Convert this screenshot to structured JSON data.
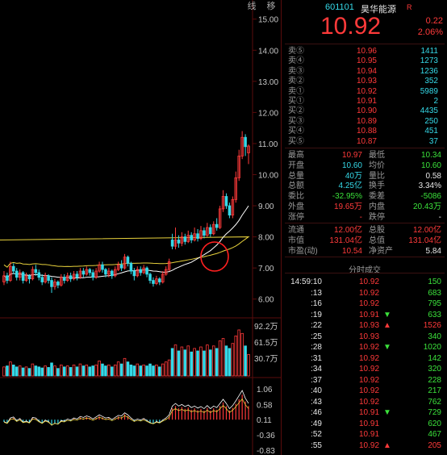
{
  "chart_tabs": [
    "线",
    "移"
  ],
  "price_axis": [
    "15.00",
    "14.00",
    "13.00",
    "12.00",
    "11.00",
    "10.00",
    "9.00",
    "8.00",
    "7.00",
    "6.00"
  ],
  "volume_axis": [
    "92.2万",
    "61.5万",
    "30.7万"
  ],
  "macd_axis": [
    "1.06",
    "0.58",
    "0.11",
    "-0.36",
    "-0.83"
  ],
  "colors": {
    "up": "#ff3a3a",
    "down": "#35d9e8",
    "flat": "#3be23b",
    "ma_white": "#ffffff",
    "ma_yellow": "#e8d23c",
    "grid": "#5a0c0c"
  },
  "stock": {
    "code": "601101",
    "name": "昊华能源",
    "flag": "R",
    "price": "10.92",
    "change": "0.22",
    "change_pct": "2.06%"
  },
  "order_book": [
    {
      "label": "卖⑤",
      "price": "10.96",
      "volume": "1411"
    },
    {
      "label": "卖④",
      "price": "10.95",
      "volume": "1273"
    },
    {
      "label": "卖③",
      "price": "10.94",
      "volume": "1236"
    },
    {
      "label": "卖②",
      "price": "10.93",
      "volume": "352"
    },
    {
      "label": "卖①",
      "price": "10.92",
      "volume": "5989"
    },
    {
      "label": "买①",
      "price": "10.91",
      "volume": "2"
    },
    {
      "label": "买②",
      "price": "10.90",
      "volume": "4435"
    },
    {
      "label": "买③",
      "price": "10.89",
      "volume": "250"
    },
    {
      "label": "买④",
      "price": "10.88",
      "volume": "451"
    },
    {
      "label": "买⑤",
      "price": "10.87",
      "volume": "37"
    }
  ],
  "stats": [
    {
      "l1": "最高",
      "v1": "10.97",
      "l2": "最低",
      "v2": "10.34"
    },
    {
      "l1": "开盘",
      "v1": "10.60",
      "l2": "均价",
      "v2": "10.60"
    },
    {
      "l1": "总量",
      "v1": "40万",
      "l2": "量比",
      "v2": "0.58"
    },
    {
      "l1": "总额",
      "v1": "4.25亿",
      "l2": "换手",
      "v2": "3.34%"
    },
    {
      "l1": "委比",
      "v1": "-32.95%",
      "l2": "委差",
      "v2": "-5086"
    },
    {
      "l1": "外盘",
      "v1": "19.65万",
      "l2": "内盘",
      "v2": "20.43万"
    },
    {
      "l1": "涨停",
      "v1": "-",
      "l2": "跌停",
      "v2": "-"
    }
  ],
  "stats2": [
    {
      "l1": "流通",
      "v1": "12.00亿",
      "l2": "总股",
      "v2": "12.00亿"
    },
    {
      "l1": "市值",
      "v1": "131.04亿",
      "l2": "总值",
      "v2": "131.04亿"
    },
    {
      "l1": "市盈(动)",
      "v1": "10.54",
      "l2": "净资产",
      "v2": "5.84"
    }
  ],
  "ticks_title": "分时成交",
  "ticks": [
    {
      "time": "14:59:10",
      "price": "10.92",
      "vol": "150",
      "arrow": ""
    },
    {
      "time": ":13",
      "price": "10.92",
      "vol": "683",
      "arrow": ""
    },
    {
      "time": ":16",
      "price": "10.92",
      "vol": "795",
      "arrow": ""
    },
    {
      "time": ":19",
      "price": "10.91",
      "vol": "633",
      "arrow": "▼"
    },
    {
      "time": ":22",
      "price": "10.93",
      "vol": "1526",
      "arrow": "▲"
    },
    {
      "time": ":25",
      "price": "10.93",
      "vol": "340",
      "arrow": ""
    },
    {
      "time": ":28",
      "price": "10.92",
      "vol": "1020",
      "arrow": "▼"
    },
    {
      "time": ":31",
      "price": "10.92",
      "vol": "142",
      "arrow": ""
    },
    {
      "time": ":34",
      "price": "10.92",
      "vol": "320",
      "arrow": ""
    },
    {
      "time": ":37",
      "price": "10.92",
      "vol": "228",
      "arrow": ""
    },
    {
      "time": ":40",
      "price": "10.92",
      "vol": "217",
      "arrow": ""
    },
    {
      "time": ":43",
      "price": "10.92",
      "vol": "762",
      "arrow": ""
    },
    {
      "time": ":46",
      "price": "10.91",
      "vol": "729",
      "arrow": "▼"
    },
    {
      "time": ":49",
      "price": "10.91",
      "vol": "620",
      "arrow": ""
    },
    {
      "time": ":52",
      "price": "10.91",
      "vol": "467",
      "arrow": ""
    },
    {
      "time": ":55",
      "price": "10.92",
      "vol": "205",
      "arrow": "▲"
    }
  ],
  "chart_data": {
    "type": "candlestick",
    "ylim": [
      5.5,
      15.2
    ],
    "candles": [
      [
        6.55,
        6.75,
        6.45,
        6.9
      ],
      [
        6.75,
        6.6,
        6.5,
        6.85
      ],
      [
        6.6,
        7.05,
        6.55,
        7.2
      ],
      [
        7.05,
        6.9,
        6.8,
        7.15
      ],
      [
        6.9,
        6.7,
        6.6,
        7.0
      ],
      [
        6.7,
        6.85,
        6.6,
        6.95
      ],
      [
        6.85,
        6.6,
        6.5,
        6.9
      ],
      [
        6.6,
        6.75,
        6.55,
        6.85
      ],
      [
        6.75,
        6.65,
        6.5,
        6.8
      ],
      [
        6.65,
        6.95,
        6.6,
        7.05
      ],
      [
        6.95,
        6.85,
        6.75,
        7.1
      ],
      [
        6.85,
        6.7,
        6.6,
        6.95
      ],
      [
        6.7,
        6.55,
        6.45,
        6.8
      ],
      [
        6.55,
        6.75,
        6.5,
        6.85
      ],
      [
        6.75,
        6.6,
        6.5,
        6.8
      ],
      [
        6.6,
        6.4,
        6.2,
        6.7
      ],
      [
        6.4,
        6.55,
        6.3,
        6.65
      ],
      [
        6.55,
        6.45,
        6.35,
        6.6
      ],
      [
        6.45,
        6.7,
        6.4,
        6.8
      ],
      [
        6.7,
        6.6,
        6.5,
        6.8
      ],
      [
        6.6,
        6.75,
        6.55,
        6.85
      ],
      [
        6.75,
        6.65,
        6.55,
        6.85
      ],
      [
        6.65,
        6.8,
        6.6,
        6.9
      ],
      [
        6.8,
        6.7,
        6.6,
        6.9
      ],
      [
        6.7,
        6.9,
        6.65,
        7.0
      ],
      [
        6.9,
        6.8,
        6.7,
        7.0
      ],
      [
        6.8,
        6.95,
        6.75,
        7.05
      ],
      [
        6.95,
        6.85,
        6.75,
        7.0
      ],
      [
        6.85,
        6.7,
        6.6,
        6.95
      ],
      [
        6.7,
        6.9,
        6.65,
        7.0
      ],
      [
        6.9,
        7.1,
        6.85,
        7.2
      ],
      [
        7.1,
        6.95,
        6.85,
        7.2
      ],
      [
        6.95,
        6.8,
        6.7,
        7.0
      ],
      [
        6.8,
        6.9,
        6.7,
        7.0
      ],
      [
        6.9,
        6.75,
        6.65,
        6.95
      ],
      [
        6.75,
        6.95,
        6.7,
        7.05
      ],
      [
        6.95,
        7.1,
        6.9,
        7.2
      ],
      [
        7.1,
        7.0,
        6.9,
        7.25
      ],
      [
        7.0,
        7.35,
        6.95,
        7.45
      ],
      [
        7.35,
        7.15,
        7.05,
        7.4
      ],
      [
        7.15,
        6.9,
        6.8,
        7.2
      ],
      [
        6.9,
        6.75,
        6.6,
        7.0
      ],
      [
        6.75,
        6.95,
        6.7,
        7.05
      ],
      [
        6.95,
        6.85,
        6.75,
        7.05
      ],
      [
        6.85,
        7.0,
        6.8,
        7.1
      ],
      [
        7.0,
        6.8,
        6.7,
        7.05
      ],
      [
        6.8,
        6.6,
        6.5,
        6.85
      ],
      [
        6.6,
        6.5,
        6.4,
        6.7
      ],
      [
        6.5,
        6.65,
        6.45,
        6.75
      ],
      [
        6.65,
        6.55,
        6.45,
        6.7
      ],
      [
        6.55,
        6.8,
        6.5,
        6.9
      ],
      [
        6.8,
        6.95,
        6.75,
        7.05
      ],
      [
        6.95,
        7.2,
        6.9,
        7.3
      ],
      [
        7.9,
        7.7,
        7.6,
        8.1
      ],
      [
        7.7,
        7.9,
        7.6,
        8.3
      ],
      [
        7.9,
        7.8,
        7.65,
        8.05
      ],
      [
        7.8,
        8.0,
        7.7,
        8.15
      ],
      [
        8.0,
        7.85,
        7.75,
        8.1
      ],
      [
        7.85,
        8.05,
        7.8,
        8.2
      ],
      [
        8.05,
        7.9,
        7.8,
        8.15
      ],
      [
        7.9,
        8.1,
        7.85,
        8.3
      ],
      [
        8.1,
        7.95,
        7.85,
        8.25
      ],
      [
        7.95,
        8.2,
        7.9,
        8.35
      ],
      [
        8.2,
        8.05,
        7.95,
        8.3
      ],
      [
        8.05,
        8.3,
        8.0,
        8.45
      ],
      [
        8.3,
        8.1,
        8.0,
        8.4
      ],
      [
        8.1,
        8.4,
        8.05,
        8.5
      ],
      [
        8.4,
        8.3,
        8.2,
        8.6
      ],
      [
        8.3,
        8.9,
        8.25,
        9.0
      ],
      [
        8.9,
        9.3,
        8.8,
        9.5
      ],
      [
        9.3,
        9.0,
        8.9,
        9.4
      ],
      [
        9.0,
        8.7,
        8.6,
        9.1
      ],
      [
        8.7,
        9.2,
        8.6,
        9.3
      ],
      [
        9.2,
        9.9,
        9.1,
        10.1
      ],
      [
        9.9,
        10.6,
        9.8,
        10.8
      ],
      [
        10.6,
        11.2,
        10.5,
        11.4
      ],
      [
        11.2,
        10.9,
        10.6,
        11.3
      ],
      [
        10.7,
        10.92,
        10.34,
        10.97
      ]
    ],
    "volumes": [
      0.18,
      0.2,
      0.28,
      0.22,
      0.18,
      0.2,
      0.16,
      0.18,
      0.15,
      0.24,
      0.2,
      0.18,
      0.16,
      0.2,
      0.17,
      0.26,
      0.2,
      0.15,
      0.22,
      0.18,
      0.2,
      0.17,
      0.22,
      0.18,
      0.24,
      0.2,
      0.22,
      0.18,
      0.2,
      0.22,
      0.3,
      0.24,
      0.2,
      0.22,
      0.18,
      0.22,
      0.28,
      0.24,
      0.35,
      0.28,
      0.22,
      0.2,
      0.24,
      0.2,
      0.22,
      0.2,
      0.24,
      0.2,
      0.22,
      0.18,
      0.24,
      0.28,
      0.32,
      0.55,
      0.62,
      0.5,
      0.58,
      0.52,
      0.6,
      0.48,
      0.55,
      0.5,
      0.58,
      0.5,
      0.62,
      0.52,
      0.6,
      0.55,
      0.7,
      0.75,
      0.6,
      0.55,
      0.65,
      0.8,
      0.92,
      0.85,
      0.6,
      0.43
    ],
    "macd": [
      -0.05,
      -0.08,
      0.02,
      0.04,
      -0.03,
      0.01,
      -0.06,
      -0.04,
      -0.07,
      0.03,
      0.02,
      -0.04,
      -0.08,
      -0.02,
      -0.05,
      -0.12,
      -0.08,
      -0.1,
      -0.03,
      -0.04,
      0.0,
      -0.02,
      0.02,
      0.0,
      0.05,
      0.03,
      0.06,
      0.04,
      0.0,
      0.04,
      0.08,
      0.05,
      0.02,
      0.03,
      -0.01,
      0.03,
      0.07,
      0.06,
      0.12,
      0.08,
      0.02,
      -0.03,
      0.0,
      -0.02,
      0.01,
      -0.03,
      -0.07,
      -0.09,
      -0.05,
      -0.07,
      -0.02,
      0.02,
      0.08,
      0.25,
      0.3,
      0.25,
      0.28,
      0.24,
      0.27,
      0.22,
      0.25,
      0.21,
      0.24,
      0.2,
      0.26,
      0.2,
      0.25,
      0.22,
      0.3,
      0.38,
      0.3,
      0.2,
      0.26,
      0.35,
      0.45,
      0.55,
      0.4,
      0.3
    ],
    "annotation": "circle at breakout near 7.3"
  }
}
